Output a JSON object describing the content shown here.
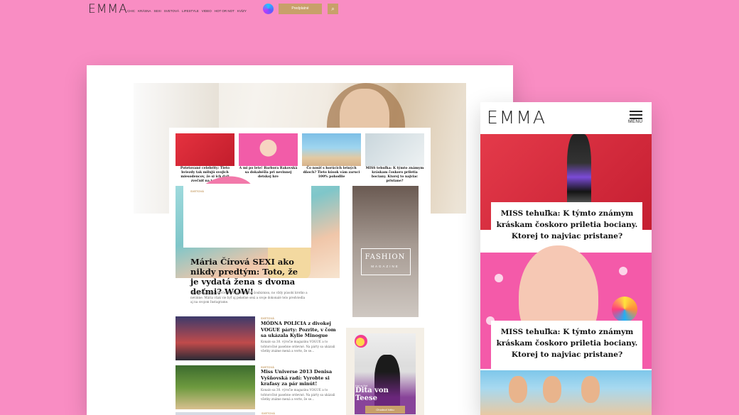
{
  "desktop": {
    "logo": "EMMA",
    "nav": [
      "CHIC",
      "KRÁSNA",
      "SEXI",
      "SVETOVÁ",
      "LIFESTYLE",
      "VIDEO",
      "HOT OR NOT",
      "KVÍZY"
    ],
    "instagram_icon": "instagram-icon",
    "subscribe_label": "Predplatné",
    "search_icon": "search-icon",
    "top_stories": [
      {
        "caption": "Potetované celebrity: Tieto hviezdy tak milujú svojich miesodencov, že si ich dali zvečniť na telo!"
      },
      {
        "caption": "A mi po lete! Barbora Rakovská sa dokabéšla pri nevinnej detskej hre"
      },
      {
        "caption": "Čo nosíť s horúcich letných dňoch? Tieto kúsok vám zaruci 100% pohodlie"
      },
      {
        "caption": "MISS tehuľka: K týmto známym kráskam čoskoro priletia bociany. Ktorej to najviac pristane?"
      }
    ],
    "main_story": {
      "category": "SVETOVÁ",
      "title": "Mária Čírová SEXI ako nikdy predtým: Toto, že je vydatá žena s dvoma deťmi? WOW!",
      "excerpt": "Patrí k najlepšie oblečeným ženám našho šoubiznisu, no vždy púsobí krotko a nevinne. Mária však vie byť aj pekelne sexi a svoje dokonalé telo predviedla aj na svojom Instagrame."
    },
    "fashion_ad": {
      "label": "FASHION",
      "sub": "MAGAZINE"
    },
    "articles": [
      {
        "category": "SVETOVÁ",
        "title": "MÓDNA POLÍCIA z divokej VOGUE párty: Pozrite, v čom sa ukázala Kylie Minogue",
        "excerpt": "Konalo sa 30. výročie magazínu VOGUE a to tohtoročné pasebne ordevné. Na párty sa ukázali všetky známe mená a verte, že se..."
      },
      {
        "category": "SVETOVÁ",
        "title": "Miss Universe 2013 Denisa Vyšňovská radí: Vyrobte si krafasy za pár minút!",
        "excerpt": "Konalo sa 30. výročie magazínu VOGUE a to tohtoročné pasebne ordevné. Na párty sa ukázali všetky známe mená a verte, že se..."
      }
    ],
    "next_category": "SVETOVÁ",
    "dita": {
      "label": "Hot or Not",
      "name": "Dita von Teese",
      "button": "Ohodnoť fotku"
    }
  },
  "mobile": {
    "logo": "EMMA",
    "menu_label": "MENU",
    "cards": [
      {
        "title": "MISS tehuľka: K týmto známym kráskam čoskoro priletia bociany. Ktorej to najviac pristane?"
      },
      {
        "title": "MISS tehuľka: K týmto známym kráskam čoskoro priletia bociany. Ktorej to najviac pristane?"
      }
    ]
  },
  "colors": {
    "background": "#f98dc3",
    "accent": "#c8a06a",
    "white": "#ffffff"
  }
}
